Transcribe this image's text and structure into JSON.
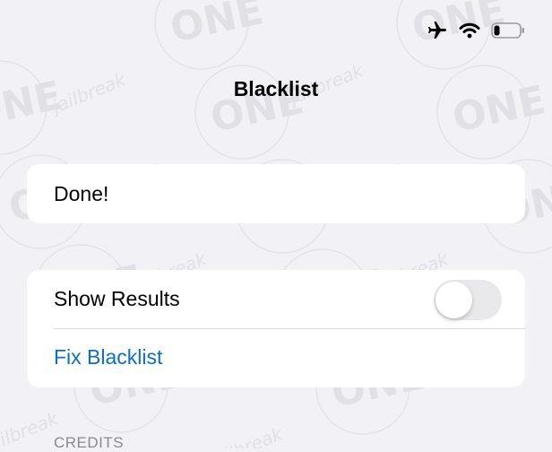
{
  "status_bar": {
    "icons": [
      "airplane-icon",
      "wifi-icon",
      "battery-icon"
    ]
  },
  "nav": {
    "title": "Blacklist"
  },
  "status_row": {
    "text": "Done!"
  },
  "actions": {
    "show_results_label": "Show Results",
    "show_results_enabled": false,
    "fix_blacklist_label": "Fix Blacklist"
  },
  "footer": {
    "credits_label": "CREDITS"
  },
  "watermark": {
    "logo_text": "ONE",
    "tag_text": "jailbreak"
  },
  "colors": {
    "background": "#F2F1F6",
    "card": "#FFFFFF",
    "link": "#0A6ECB",
    "toggle_off": "#E9E9EB",
    "secondary_text": "#8A8A8E"
  }
}
